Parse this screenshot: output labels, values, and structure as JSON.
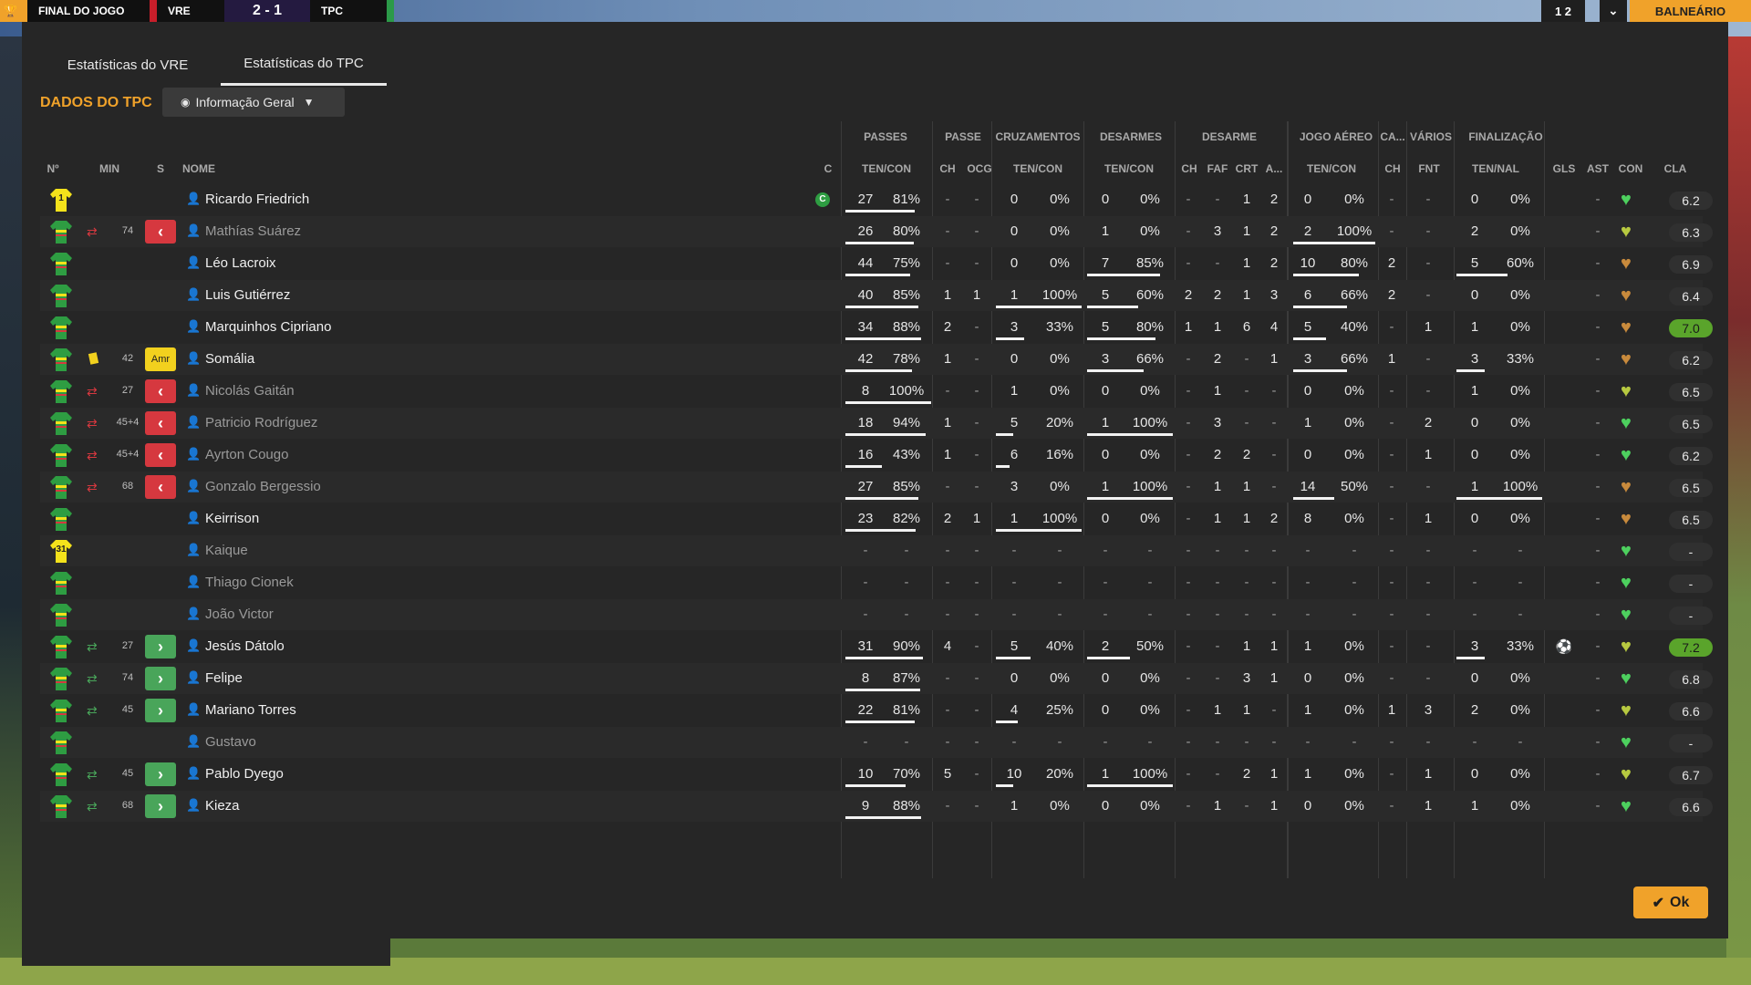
{
  "scorebar": {
    "phase": "FINAL DO JOGO",
    "home": "VRE",
    "score": "2 - 1",
    "away": "TPC"
  },
  "topright": {
    "left": "1 2",
    "right": "BALNEÁRIO"
  },
  "tabs": [
    {
      "label": "Estatísticas do VRE"
    },
    {
      "label": "Estatísticas do TPC"
    }
  ],
  "section_title": "DADOS DO TPC",
  "view_select": {
    "label": "Informação Geral"
  },
  "group_headers": [
    "PASSES",
    "PASSE",
    "CRUZAMENTOS",
    "DESARMES",
    "DESARME",
    "JOGO AÉREO",
    "CA...",
    "VÁRIOS",
    "FINALIZAÇÃO"
  ],
  "column_headers": {
    "num": "Nº",
    "min": "MIN",
    "s": "S",
    "name": "NOME",
    "c": "C",
    "passes": "TEN/CON",
    "passe_ch": "CH",
    "passe_ocg": "OCG",
    "cruz": "TEN/CON",
    "desarmes": "TEN/CON",
    "des_ch": "CH",
    "des_faf": "FAF",
    "des_crt": "CRT",
    "des_a": "A...",
    "aereo": "TEN/CON",
    "ca_ch": "CH",
    "varios_fnt": "FNT",
    "final": "TEN/NAL",
    "gls": "GLS",
    "ast": "AST",
    "con": "CON",
    "cla": "CLA"
  },
  "ok_label": "Ok",
  "colors": {
    "accent": "#f0a22a",
    "panel": "#262626",
    "rating_good": "#5aa42b",
    "heart_green": "#4dd05e",
    "heart_olive": "#b7c940",
    "heart_brown": "#c88a3c",
    "sub_out": "#d6383f",
    "sub_in": "#49a55a",
    "yellow_card": "#f2d11e"
  },
  "players": [
    {
      "num": "1",
      "gk": true,
      "min": "",
      "s": "",
      "name": "Ricardo Friedrich",
      "dim": false,
      "captain": "C",
      "passes": [
        "27",
        "81%"
      ],
      "passe": [
        "-",
        "-"
      ],
      "cruz": [
        "0",
        "0%"
      ],
      "desarmes": [
        "0",
        "0%"
      ],
      "des": [
        "-",
        "-",
        "1",
        "2"
      ],
      "aereo": [
        "0",
        "0%"
      ],
      "ca": "-",
      "fnt": "-",
      "final": [
        "0",
        "0%"
      ],
      "gls": "",
      "ast": "-",
      "heart": "green",
      "cla": "6.2",
      "top": false
    },
    {
      "num": "",
      "gk": false,
      "sub": "swap",
      "min": "74",
      "s": "out",
      "name": "Mathías Suárez",
      "dim": true,
      "passes": [
        "26",
        "80%"
      ],
      "passe": [
        "-",
        "-"
      ],
      "cruz": [
        "0",
        "0%"
      ],
      "desarmes": [
        "1",
        "0%"
      ],
      "des": [
        "-",
        "3",
        "1",
        "2"
      ],
      "aereo": [
        "2",
        "100%"
      ],
      "ca": "-",
      "fnt": "-",
      "final": [
        "2",
        "0%"
      ],
      "gls": "",
      "ast": "-",
      "heart": "olive",
      "cla": "6.3",
      "top": false
    },
    {
      "num": "",
      "gk": false,
      "min": "",
      "s": "",
      "name": "Léo Lacroix",
      "dim": false,
      "passes": [
        "44",
        "75%"
      ],
      "passe": [
        "-",
        "-"
      ],
      "cruz": [
        "0",
        "0%"
      ],
      "desarmes": [
        "7",
        "85%"
      ],
      "des": [
        "-",
        "-",
        "1",
        "2"
      ],
      "aereo": [
        "10",
        "80%"
      ],
      "ca": "2",
      "fnt": "-",
      "final": [
        "5",
        "60%"
      ],
      "gls": "",
      "ast": "-",
      "heart": "brown",
      "cla": "6.9",
      "top": false
    },
    {
      "num": "",
      "gk": false,
      "min": "",
      "s": "",
      "name": "Luis Gutiérrez",
      "dim": false,
      "passes": [
        "40",
        "85%"
      ],
      "passe": [
        "1",
        "1"
      ],
      "cruz": [
        "1",
        "100%"
      ],
      "desarmes": [
        "5",
        "60%"
      ],
      "des": [
        "2",
        "2",
        "1",
        "3"
      ],
      "aereo": [
        "6",
        "66%"
      ],
      "ca": "2",
      "fnt": "-",
      "final": [
        "0",
        "0%"
      ],
      "gls": "",
      "ast": "-",
      "heart": "brown",
      "cla": "6.4",
      "top": false
    },
    {
      "num": "",
      "gk": false,
      "min": "",
      "s": "",
      "name": "Marquinhos Cipriano",
      "dim": false,
      "passes": [
        "34",
        "88%"
      ],
      "passe": [
        "2",
        "-"
      ],
      "cruz": [
        "3",
        "33%"
      ],
      "desarmes": [
        "5",
        "80%"
      ],
      "des": [
        "1",
        "1",
        "6",
        "4"
      ],
      "aereo": [
        "5",
        "40%"
      ],
      "ca": "-",
      "fnt": "1",
      "final": [
        "1",
        "0%"
      ],
      "gls": "",
      "ast": "-",
      "heart": "brown",
      "cla": "7.0",
      "top": true
    },
    {
      "num": "",
      "gk": false,
      "sub": "card",
      "min": "42",
      "s": "Amr",
      "name": "Somália",
      "dim": false,
      "passes": [
        "42",
        "78%"
      ],
      "passe": [
        "1",
        "-"
      ],
      "cruz": [
        "0",
        "0%"
      ],
      "desarmes": [
        "3",
        "66%"
      ],
      "des": [
        "-",
        "2",
        "-",
        "1"
      ],
      "aereo": [
        "3",
        "66%"
      ],
      "ca": "1",
      "fnt": "-",
      "final": [
        "3",
        "33%"
      ],
      "gls": "",
      "ast": "-",
      "heart": "brown",
      "cla": "6.2",
      "top": false
    },
    {
      "num": "",
      "gk": false,
      "sub": "swap",
      "min": "27",
      "s": "out",
      "name": "Nicolás Gaitán",
      "dim": true,
      "passes": [
        "8",
        "100%"
      ],
      "passe": [
        "-",
        "-"
      ],
      "cruz": [
        "1",
        "0%"
      ],
      "desarmes": [
        "0",
        "0%"
      ],
      "des": [
        "-",
        "1",
        "-",
        "-"
      ],
      "aereo": [
        "0",
        "0%"
      ],
      "ca": "-",
      "fnt": "-",
      "final": [
        "1",
        "0%"
      ],
      "gls": "",
      "ast": "-",
      "heart": "olive",
      "cla": "6.5",
      "top": false
    },
    {
      "num": "",
      "gk": false,
      "sub": "swap",
      "min": "45+4",
      "s": "out",
      "name": "Patricio Rodríguez",
      "dim": true,
      "passes": [
        "18",
        "94%"
      ],
      "passe": [
        "1",
        "-"
      ],
      "cruz": [
        "5",
        "20%"
      ],
      "desarmes": [
        "1",
        "100%"
      ],
      "des": [
        "-",
        "3",
        "-",
        "-"
      ],
      "aereo": [
        "1",
        "0%"
      ],
      "ca": "-",
      "fnt": "2",
      "final": [
        "0",
        "0%"
      ],
      "gls": "",
      "ast": "-",
      "heart": "green",
      "cla": "6.5",
      "top": false
    },
    {
      "num": "",
      "gk": false,
      "sub": "swap",
      "min": "45+4",
      "s": "out",
      "name": "Ayrton Cougo",
      "dim": true,
      "passes": [
        "16",
        "43%"
      ],
      "passe": [
        "1",
        "-"
      ],
      "cruz": [
        "6",
        "16%"
      ],
      "desarmes": [
        "0",
        "0%"
      ],
      "des": [
        "-",
        "2",
        "2",
        "-"
      ],
      "aereo": [
        "0",
        "0%"
      ],
      "ca": "-",
      "fnt": "1",
      "final": [
        "0",
        "0%"
      ],
      "gls": "",
      "ast": "-",
      "heart": "green",
      "cla": "6.2",
      "top": false
    },
    {
      "num": "",
      "gk": false,
      "sub": "swap",
      "min": "68",
      "s": "out",
      "name": "Gonzalo Bergessio",
      "dim": true,
      "passes": [
        "27",
        "85%"
      ],
      "passe": [
        "-",
        "-"
      ],
      "cruz": [
        "3",
        "0%"
      ],
      "desarmes": [
        "1",
        "100%"
      ],
      "des": [
        "-",
        "1",
        "1",
        "-"
      ],
      "aereo": [
        "14",
        "50%"
      ],
      "ca": "-",
      "fnt": "-",
      "final": [
        "1",
        "100%"
      ],
      "gls": "",
      "ast": "-",
      "heart": "brown",
      "cla": "6.5",
      "top": false
    },
    {
      "num": "",
      "gk": false,
      "min": "",
      "s": "",
      "name": "Keirrison",
      "dim": false,
      "passes": [
        "23",
        "82%"
      ],
      "passe": [
        "2",
        "1"
      ],
      "cruz": [
        "1",
        "100%"
      ],
      "desarmes": [
        "0",
        "0%"
      ],
      "des": [
        "-",
        "1",
        "1",
        "2"
      ],
      "aereo": [
        "8",
        "0%"
      ],
      "ca": "-",
      "fnt": "1",
      "final": [
        "0",
        "0%"
      ],
      "gls": "",
      "ast": "-",
      "heart": "brown",
      "cla": "6.5",
      "top": false
    },
    {
      "num": "31",
      "gk": true,
      "min": "",
      "s": "",
      "name": "Kaique",
      "dim": true,
      "passes": [
        "-",
        "-"
      ],
      "passe": [
        "-",
        "-"
      ],
      "cruz": [
        "-",
        "-"
      ],
      "desarmes": [
        "-",
        "-"
      ],
      "des": [
        "-",
        "-",
        "-",
        "-"
      ],
      "aereo": [
        "-",
        "-"
      ],
      "ca": "-",
      "fnt": "-",
      "final": [
        "-",
        "-"
      ],
      "gls": "",
      "ast": "-",
      "heart": "green",
      "cla": "-",
      "top": false
    },
    {
      "num": "",
      "gk": false,
      "min": "",
      "s": "",
      "name": "Thiago Cionek",
      "dim": true,
      "passes": [
        "-",
        "-"
      ],
      "passe": [
        "-",
        "-"
      ],
      "cruz": [
        "-",
        "-"
      ],
      "desarmes": [
        "-",
        "-"
      ],
      "des": [
        "-",
        "-",
        "-",
        "-"
      ],
      "aereo": [
        "-",
        "-"
      ],
      "ca": "-",
      "fnt": "-",
      "final": [
        "-",
        "-"
      ],
      "gls": "",
      "ast": "-",
      "heart": "green",
      "cla": "-",
      "top": false
    },
    {
      "num": "",
      "gk": false,
      "min": "",
      "s": "",
      "name": "João Victor",
      "dim": true,
      "passes": [
        "-",
        "-"
      ],
      "passe": [
        "-",
        "-"
      ],
      "cruz": [
        "-",
        "-"
      ],
      "desarmes": [
        "-",
        "-"
      ],
      "des": [
        "-",
        "-",
        "-",
        "-"
      ],
      "aereo": [
        "-",
        "-"
      ],
      "ca": "-",
      "fnt": "-",
      "final": [
        "-",
        "-"
      ],
      "gls": "",
      "ast": "-",
      "heart": "green",
      "cla": "-",
      "top": false
    },
    {
      "num": "",
      "gk": false,
      "sub": "in",
      "min": "27",
      "s": "in",
      "name": "Jesús Dátolo",
      "dim": false,
      "passes": [
        "31",
        "90%"
      ],
      "passe": [
        "4",
        "-"
      ],
      "cruz": [
        "5",
        "40%"
      ],
      "desarmes": [
        "2",
        "50%"
      ],
      "des": [
        "-",
        "-",
        "1",
        "1"
      ],
      "aereo": [
        "1",
        "0%"
      ],
      "ca": "-",
      "fnt": "-",
      "final": [
        "3",
        "33%"
      ],
      "gls": "⚽",
      "ast": "-",
      "heart": "olive",
      "cla": "7.2",
      "top": true
    },
    {
      "num": "",
      "gk": false,
      "sub": "in",
      "min": "74",
      "s": "in",
      "name": "Felipe",
      "dim": false,
      "passes": [
        "8",
        "87%"
      ],
      "passe": [
        "-",
        "-"
      ],
      "cruz": [
        "0",
        "0%"
      ],
      "desarmes": [
        "0",
        "0%"
      ],
      "des": [
        "-",
        "-",
        "3",
        "1"
      ],
      "aereo": [
        "0",
        "0%"
      ],
      "ca": "-",
      "fnt": "-",
      "final": [
        "0",
        "0%"
      ],
      "gls": "",
      "ast": "-",
      "heart": "green",
      "cla": "6.8",
      "top": false
    },
    {
      "num": "",
      "gk": false,
      "sub": "in",
      "min": "45",
      "s": "in",
      "name": "Mariano Torres",
      "dim": false,
      "passes": [
        "22",
        "81%"
      ],
      "passe": [
        "-",
        "-"
      ],
      "cruz": [
        "4",
        "25%"
      ],
      "desarmes": [
        "0",
        "0%"
      ],
      "des": [
        "-",
        "1",
        "1",
        "-"
      ],
      "aereo": [
        "1",
        "0%"
      ],
      "ca": "1",
      "fnt": "3",
      "final": [
        "2",
        "0%"
      ],
      "gls": "",
      "ast": "-",
      "heart": "olive",
      "cla": "6.6",
      "top": false
    },
    {
      "num": "",
      "gk": false,
      "min": "",
      "s": "",
      "name": "Gustavo",
      "dim": true,
      "passes": [
        "-",
        "-"
      ],
      "passe": [
        "-",
        "-"
      ],
      "cruz": [
        "-",
        "-"
      ],
      "desarmes": [
        "-",
        "-"
      ],
      "des": [
        "-",
        "-",
        "-",
        "-"
      ],
      "aereo": [
        "-",
        "-"
      ],
      "ca": "-",
      "fnt": "-",
      "final": [
        "-",
        "-"
      ],
      "gls": "",
      "ast": "-",
      "heart": "green",
      "cla": "-",
      "top": false
    },
    {
      "num": "",
      "gk": false,
      "sub": "in",
      "min": "45",
      "s": "in",
      "name": "Pablo Dyego",
      "dim": false,
      "passes": [
        "10",
        "70%"
      ],
      "passe": [
        "5",
        "-"
      ],
      "cruz": [
        "10",
        "20%"
      ],
      "desarmes": [
        "1",
        "100%"
      ],
      "des": [
        "-",
        "-",
        "2",
        "1"
      ],
      "aereo": [
        "1",
        "0%"
      ],
      "ca": "-",
      "fnt": "1",
      "final": [
        "0",
        "0%"
      ],
      "gls": "",
      "ast": "-",
      "heart": "olive",
      "cla": "6.7",
      "top": false
    },
    {
      "num": "",
      "gk": false,
      "sub": "in",
      "min": "68",
      "s": "in",
      "name": "Kieza",
      "dim": false,
      "passes": [
        "9",
        "88%"
      ],
      "passe": [
        "-",
        "-"
      ],
      "cruz": [
        "1",
        "0%"
      ],
      "desarmes": [
        "0",
        "0%"
      ],
      "des": [
        "-",
        "1",
        "-",
        "1"
      ],
      "aereo": [
        "0",
        "0%"
      ],
      "ca": "-",
      "fnt": "1",
      "final": [
        "1",
        "0%"
      ],
      "gls": "",
      "ast": "-",
      "heart": "green",
      "cla": "6.6",
      "top": false
    }
  ]
}
